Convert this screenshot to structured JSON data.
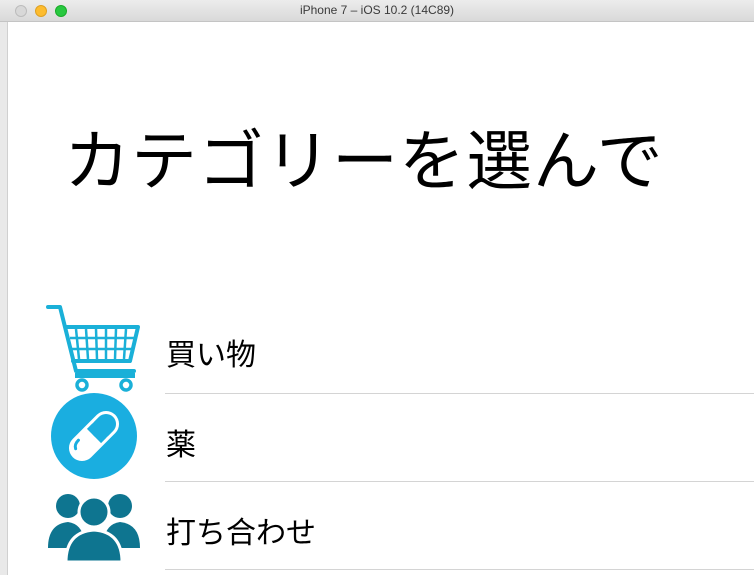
{
  "window": {
    "title": "iPhone 7 – iOS 10.2 (14C89)"
  },
  "screen": {
    "heading": "カテゴリーを選んで"
  },
  "categories": [
    {
      "label": "買い物",
      "icon": "shopping-cart-icon",
      "color": "#1ab0d8"
    },
    {
      "label": "薬",
      "icon": "pill-icon",
      "color": "#1aaee0"
    },
    {
      "label": "打ち合わせ",
      "icon": "people-icon",
      "color": "#0e7590"
    }
  ]
}
